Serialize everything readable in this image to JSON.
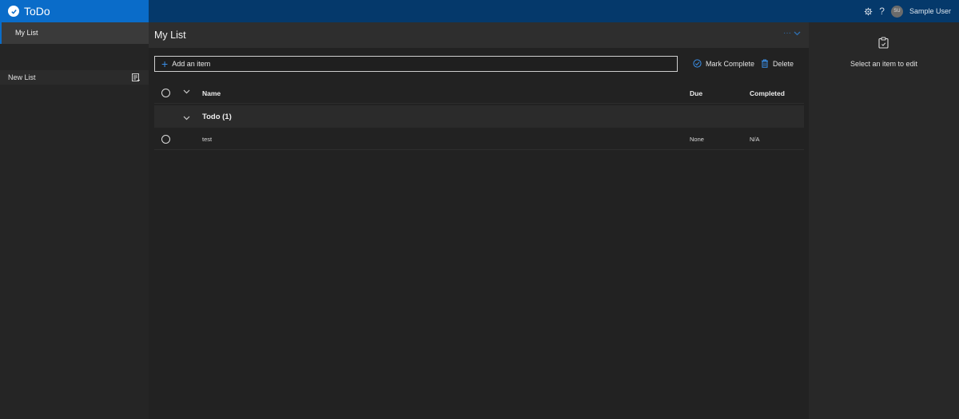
{
  "app": {
    "title": "ToDo"
  },
  "topbar": {
    "settings_icon": "gear-icon",
    "help_label": "?",
    "avatar_initials": "SU",
    "user_name": "Sample User"
  },
  "sidebar": {
    "active_item": "My List",
    "new_list_label": "New List"
  },
  "main": {
    "title": "My List",
    "more_label": "···",
    "add_item_placeholder": "Add an item",
    "mark_complete_label": "Mark Complete",
    "delete_label": "Delete",
    "columns": {
      "name": "Name",
      "due": "Due",
      "completed": "Completed"
    },
    "group": {
      "label": "Todo (1)"
    },
    "items": [
      {
        "name": "test",
        "due": "None",
        "completed": "N/A"
      }
    ]
  },
  "right_panel": {
    "message": "Select an item to edit"
  },
  "colors": {
    "brand": "#0a6cc9",
    "topbar": "#05396b",
    "accent": "#3a8ee6"
  }
}
